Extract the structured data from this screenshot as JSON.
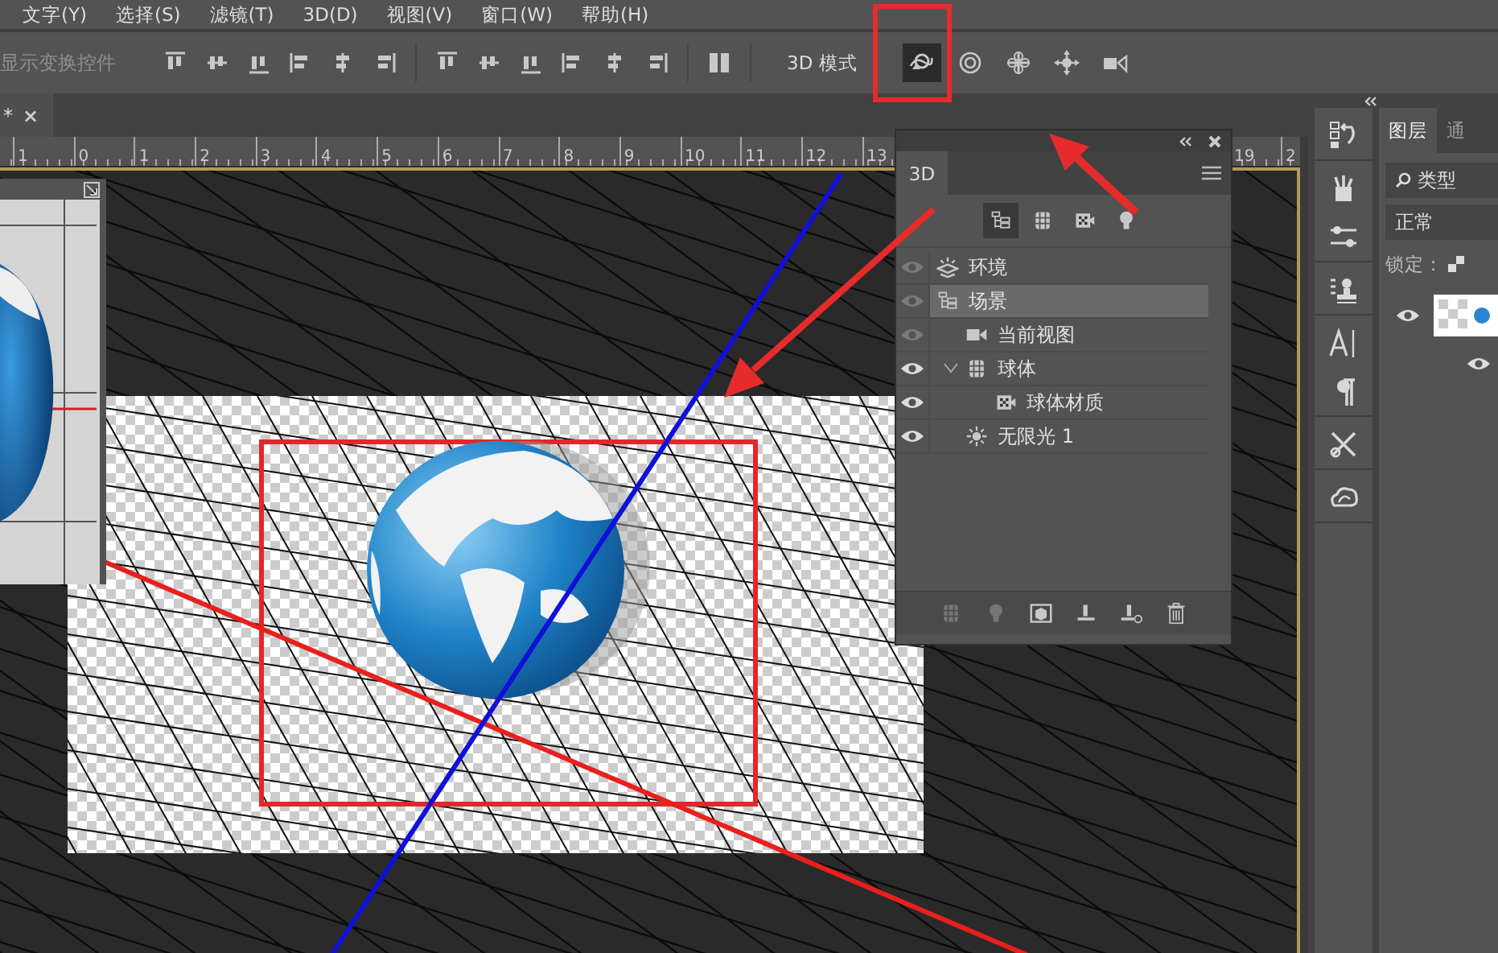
{
  "menu": [
    "文字(Y)",
    "选择(S)",
    "滤镜(T)",
    "3D(D)",
    "视图(V)",
    "窗口(W)",
    "帮助(H)"
  ],
  "options_bar": {
    "transform_label": "显示变换控件",
    "mode_label": "3D 模式",
    "mode_tools": [
      {
        "kind": "orbit",
        "selected": true
      },
      {
        "kind": "roll",
        "selected": false
      },
      {
        "kind": "pan",
        "selected": false
      },
      {
        "kind": "slide",
        "selected": false
      },
      {
        "kind": "zoom",
        "selected": false
      }
    ]
  },
  "document_tab": {
    "title": "*",
    "close": "×"
  },
  "ruler": {
    "left_numbers": [
      "1",
      "0",
      "1",
      "2",
      "3",
      "4",
      "5",
      "6",
      "7",
      "8",
      "9",
      "10",
      "11",
      "12",
      "13"
    ],
    "right_numbers": [
      "19",
      "2"
    ]
  },
  "panel_3d": {
    "tab": "3D",
    "filters": [
      {
        "kind": "scene",
        "selected": true
      },
      {
        "kind": "mesh",
        "selected": false
      },
      {
        "kind": "material",
        "selected": false
      },
      {
        "kind": "light",
        "selected": false
      }
    ],
    "tree": [
      {
        "label": "环境",
        "kind": "environment",
        "eye_active": false,
        "selected": false
      },
      {
        "label": "场景",
        "kind": "scene",
        "eye_active": false,
        "selected": true,
        "children": [
          {
            "label": "当前视图",
            "kind": "camera",
            "eye_active": false,
            "selected": false
          },
          {
            "label": "球体",
            "kind": "mesh",
            "eye_active": true,
            "selected": false,
            "expanded": true,
            "children": [
              {
                "label": "球体材质",
                "kind": "material",
                "eye_active": true,
                "selected": false
              }
            ]
          },
          {
            "label": "无限光 1",
            "kind": "light",
            "eye_active": true,
            "selected": false
          }
        ]
      }
    ],
    "footer_buttons": [
      {
        "kind": "mesh",
        "disabled": true
      },
      {
        "kind": "light",
        "disabled": true
      },
      {
        "kind": "material",
        "disabled": false
      },
      {
        "kind": "constraint",
        "disabled": false
      },
      {
        "kind": "remove-constraint",
        "disabled": false
      },
      {
        "kind": "delete",
        "disabled": false
      }
    ]
  },
  "layers_panel": {
    "tabs": [
      {
        "label": "图层",
        "selected": true
      },
      {
        "label": "通",
        "selected": false
      }
    ],
    "filter_kind": "类型",
    "blend_mode": "正常",
    "lock_label": "锁定："
  }
}
